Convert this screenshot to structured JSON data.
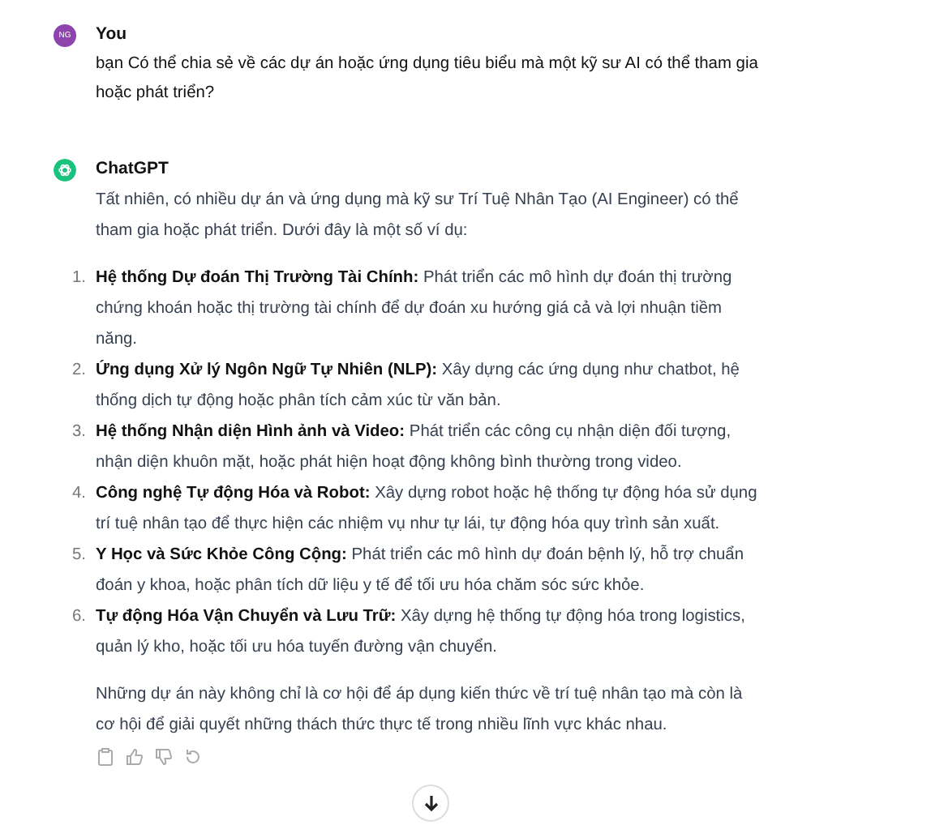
{
  "messages": [
    {
      "kind": "user",
      "avatar": "NG",
      "author": "You",
      "paragraphs": [
        "bạn Có thể chia sẻ về các dự án hoặc ứng dụng tiêu biểu mà một kỹ sư AI có thể tham gia hoặc phát triển?"
      ]
    },
    {
      "kind": "assistant",
      "author": "ChatGPT",
      "paragraphs": [
        "Tất nhiên, có nhiều dự án và ứng dụng mà kỹ sư Trí Tuệ Nhân Tạo (AI Engineer) có thể tham gia hoặc phát triển. Dưới đây là một số ví dụ:"
      ],
      "list": [
        {
          "number": "1.",
          "text": "**Hệ thống Dự đoán Thị Trường Tài Chính:** Phát triển các mô hình dự đoán thị trường chứng khoán hoặc thị trường tài chính để dự đoán xu hướng giá cả và lợi nhuận tiềm năng."
        },
        {
          "number": "2.",
          "text": "**Ứng dụng Xử lý Ngôn Ngữ Tự Nhiên (NLP):** Xây dựng các ứng dụng như chatbot, hệ thống dịch tự động hoặc phân tích cảm xúc từ văn bản."
        },
        {
          "number": "3.",
          "text": "**Hệ thống Nhận diện Hình ảnh và Video:** Phát triển các công cụ nhận diện đối tượng, nhận diện khuôn mặt, hoặc phát hiện hoạt động không bình thường trong video."
        },
        {
          "number": "4.",
          "text": "**Công nghệ Tự động Hóa và Robot:** Xây dựng robot hoặc hệ thống tự động hóa sử dụng trí tuệ nhân tạo để thực hiện các nhiệm vụ như tự lái, tự động hóa quy trình sản xuất."
        },
        {
          "number": "5.",
          "text": "**Y Học và Sức Khỏe Công Cộng:** Phát triển các mô hình dự đoán bệnh lý, hỗ trợ chuẩn đoán y khoa, hoặc phân tích dữ liệu y tế để tối ưu hóa chăm sóc sức khỏe."
        },
        {
          "number": "6.",
          "text": "**Tự động Hóa Vận Chuyển và Lưu Trữ:** Xây dựng hệ thống tự động hóa trong logistics, quản lý kho, hoặc tối ưu hóa tuyến đường vận chuyển."
        }
      ],
      "closing": "Những dự án này không chỉ là cơ hội để áp dụng kiến thức về trí tuệ nhân tạo mà còn là cơ hội để giải quyết những thách thức thực tế trong nhiều lĩnh vực khác nhau."
    }
  ]
}
